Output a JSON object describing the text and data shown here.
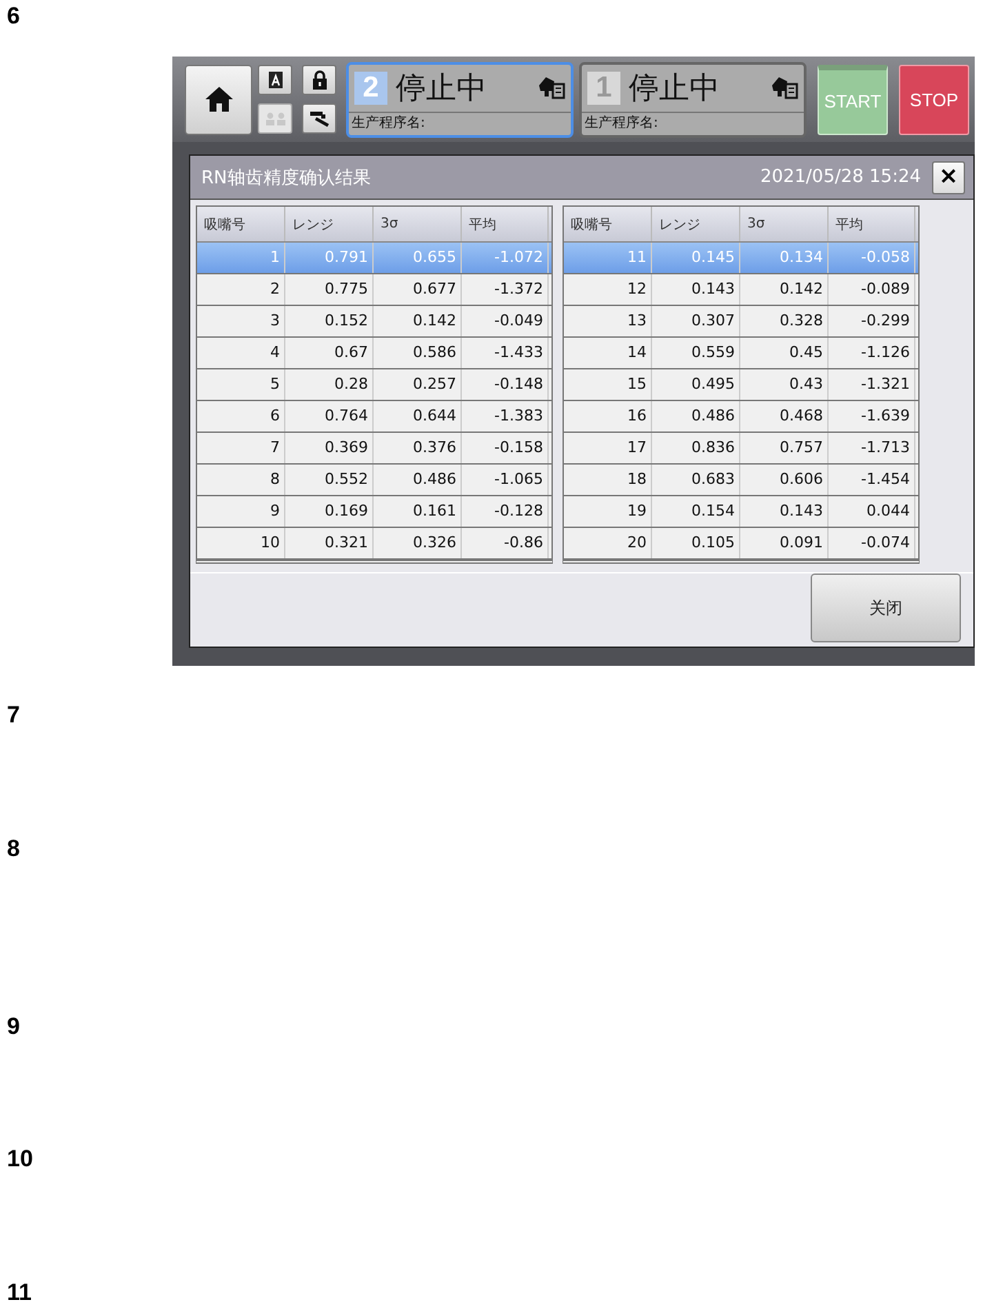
{
  "sections": [
    {
      "number": "6",
      "screen": {
        "icon_buttons": [
          {
            "kind": "letter-a",
            "disabled": false
          },
          {
            "kind": "lock",
            "disabled": false
          },
          {
            "kind": "users",
            "disabled": true
          },
          {
            "kind": "tool",
            "disabled": false
          }
        ],
        "lanes": [
          {
            "number": "2",
            "status": "停止中",
            "label": "生产程序名:",
            "selected": true
          },
          {
            "number": "1",
            "status": "停止中",
            "label": "生产程序名:",
            "selected": false
          }
        ],
        "run_buttons": [
          {
            "label": "START",
            "kind": "start"
          },
          {
            "label": "STOP",
            "kind": "stop"
          }
        ],
        "dialog": {
          "title": "RN轴齿精度确认结果",
          "datetime": "2021/05/28 15:24",
          "close_symbol": "×",
          "tables": [
            {
              "columns": [
                "吸嘴号",
                "レンジ",
                "3σ",
                "平均"
              ],
              "rows": [
                {
                  "cells": [
                    "1",
                    "0.791",
                    "0.655",
                    "-1.072"
                  ],
                  "selected": true
                },
                {
                  "cells": [
                    "2",
                    "0.775",
                    "0.677",
                    "-1.372"
                  ],
                  "selected": false
                },
                {
                  "cells": [
                    "3",
                    "0.152",
                    "0.142",
                    "-0.049"
                  ],
                  "selected": false
                },
                {
                  "cells": [
                    "4",
                    "0.67",
                    "0.586",
                    "-1.433"
                  ],
                  "selected": false
                },
                {
                  "cells": [
                    "5",
                    "0.28",
                    "0.257",
                    "-0.148"
                  ],
                  "selected": false
                },
                {
                  "cells": [
                    "6",
                    "0.764",
                    "0.644",
                    "-1.383"
                  ],
                  "selected": false
                },
                {
                  "cells": [
                    "7",
                    "0.369",
                    "0.376",
                    "-0.158"
                  ],
                  "selected": false
                },
                {
                  "cells": [
                    "8",
                    "0.552",
                    "0.486",
                    "-1.065"
                  ],
                  "selected": false
                },
                {
                  "cells": [
                    "9",
                    "0.169",
                    "0.161",
                    "-0.128"
                  ],
                  "selected": false
                },
                {
                  "cells": [
                    "10",
                    "0.321",
                    "0.326",
                    "-0.86"
                  ],
                  "selected": false
                }
              ]
            },
            {
              "columns": [
                "吸嘴号",
                "レンジ",
                "3σ",
                "平均"
              ],
              "rows": [
                {
                  "cells": [
                    "11",
                    "0.145",
                    "0.134",
                    "-0.058"
                  ],
                  "selected": true
                },
                {
                  "cells": [
                    "12",
                    "0.143",
                    "0.142",
                    "-0.089"
                  ],
                  "selected": false
                },
                {
                  "cells": [
                    "13",
                    "0.307",
                    "0.328",
                    "-0.299"
                  ],
                  "selected": false
                },
                {
                  "cells": [
                    "14",
                    "0.559",
                    "0.45",
                    "-1.126"
                  ],
                  "selected": false
                },
                {
                  "cells": [
                    "15",
                    "0.495",
                    "0.43",
                    "-1.321"
                  ],
                  "selected": false
                },
                {
                  "cells": [
                    "16",
                    "0.486",
                    "0.468",
                    "-1.639"
                  ],
                  "selected": false
                },
                {
                  "cells": [
                    "17",
                    "0.836",
                    "0.757",
                    "-1.713"
                  ],
                  "selected": false
                },
                {
                  "cells": [
                    "18",
                    "0.683",
                    "0.606",
                    "-1.454"
                  ],
                  "selected": false
                },
                {
                  "cells": [
                    "19",
                    "0.154",
                    "0.143",
                    "0.044"
                  ],
                  "selected": false
                },
                {
                  "cells": [
                    "20",
                    "0.105",
                    "0.091",
                    "-0.074"
                  ],
                  "selected": false
                }
              ]
            }
          ],
          "close_button": "关闭"
        }
      }
    },
    {
      "number": "7"
    },
    {
      "number": "8"
    },
    {
      "number": "9"
    },
    {
      "number": "10"
    },
    {
      "number": "11"
    }
  ]
}
